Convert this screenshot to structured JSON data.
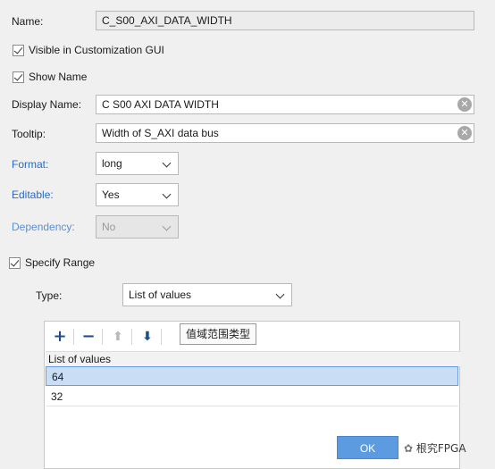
{
  "name": {
    "label": "Name:",
    "value": "C_S00_AXI_DATA_WIDTH"
  },
  "visible_in_gui": {
    "label": "Visible in Customization GUI",
    "checked": true
  },
  "show_name": {
    "label": "Show Name",
    "checked": true
  },
  "display_name": {
    "label": "Display Name:",
    "value": "C S00 AXI DATA WIDTH"
  },
  "tooltip_field": {
    "label": "Tooltip:",
    "value": "Width of S_AXI data bus"
  },
  "format": {
    "label": "Format:",
    "value": "long"
  },
  "editable": {
    "label": "Editable:",
    "value": "Yes"
  },
  "dependency": {
    "label": "Dependency:",
    "value": "No"
  },
  "specify_range": {
    "label": "Specify Range",
    "checked": true
  },
  "range_type": {
    "label": "Type:",
    "value": "List of values"
  },
  "toolbar": {
    "add_icon": "plus-icon",
    "remove_icon": "minus-icon",
    "move_up_icon": "arrow-up-icon",
    "move_down_icon": "arrow-down-icon",
    "hover_tooltip": "值域范围类型"
  },
  "values_table": {
    "header": "List of values",
    "rows": [
      "64",
      "32"
    ],
    "selected_index": 0
  },
  "buttons": {
    "ok": "OK"
  },
  "watermark": "根究FPGA",
  "colors": {
    "accent": "#5d9be0",
    "link_label": "#2a6ac4",
    "selection": "#c9def5"
  }
}
